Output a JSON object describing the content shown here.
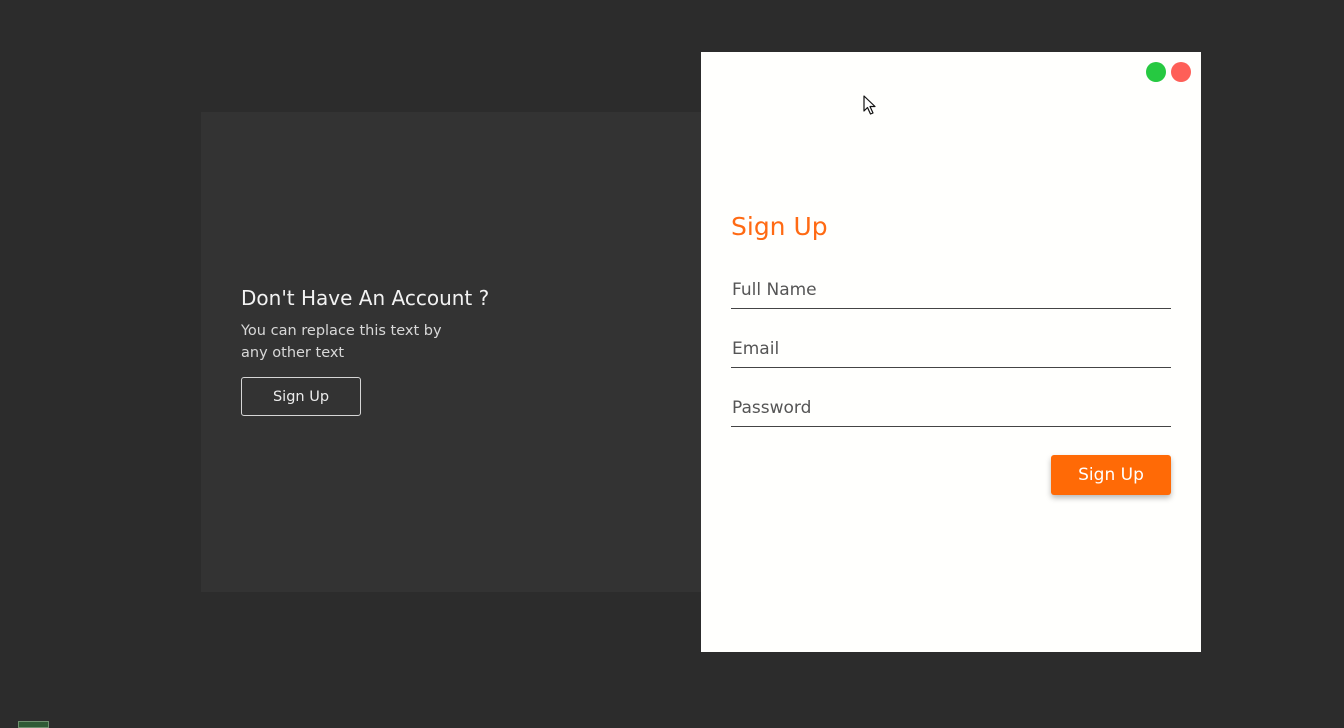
{
  "info_panel": {
    "title": "Don't Have An Account ?",
    "description": "You can replace this text by any other text",
    "button_label": "Sign Up"
  },
  "window_controls": {
    "maximize_icon": "green-circle-icon",
    "close_icon": "red-circle-icon",
    "colors": {
      "maximize": "#26c941",
      "close": "#fe5f58"
    }
  },
  "form": {
    "title": "Sign Up",
    "fields": {
      "full_name": {
        "placeholder": "Full Name",
        "value": ""
      },
      "email": {
        "placeholder": "Email",
        "value": ""
      },
      "password": {
        "placeholder": "Password",
        "value": ""
      }
    },
    "submit_label": "Sign Up"
  },
  "colors": {
    "accent": "#ff6a06",
    "background": "#2c2c2c",
    "info_panel": "#333333",
    "form_card": "#fffffd"
  },
  "taskbar": {
    "app_icon": "app-icon"
  }
}
